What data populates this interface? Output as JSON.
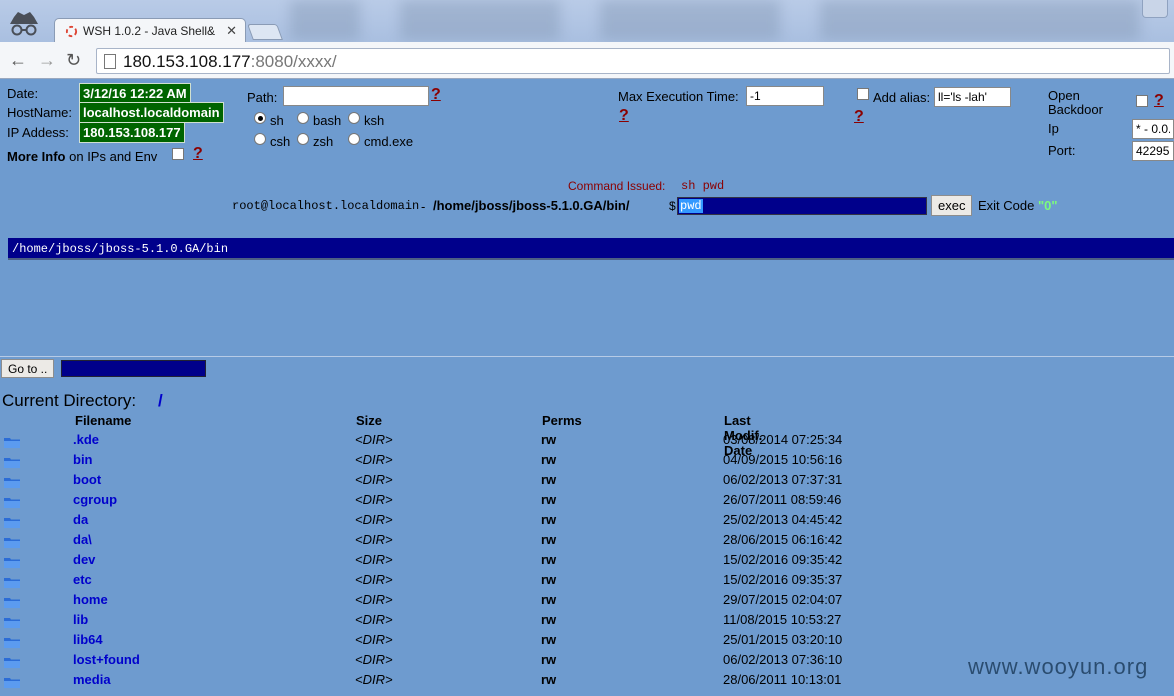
{
  "browser": {
    "tab_title": "WSH 1.0.2 - Java Shell&",
    "url_host": "180.153.108.177",
    "url_rest": ":8080/xxxx/"
  },
  "info": {
    "date_label": "Date:",
    "date_value": "3/12/16 12:22 AM",
    "hostname_label": "HostName:",
    "hostname_value": "localhost.localdomain",
    "ip_label": "IP Addess:",
    "ip_value": "180.153.108.177",
    "more_info_bold": "More Info",
    "more_info_rest": "on IPs and Env"
  },
  "shell": {
    "path_label": "Path:",
    "path_value": "",
    "help": "?",
    "options": [
      {
        "label": "sh",
        "selected": true
      },
      {
        "label": "bash",
        "selected": false
      },
      {
        "label": "ksh",
        "selected": false
      },
      {
        "label": "csh",
        "selected": false
      },
      {
        "label": "zsh",
        "selected": false
      },
      {
        "label": "cmd.exe",
        "selected": false
      }
    ]
  },
  "exec_settings": {
    "max_time_label": "Max Execution Time:",
    "max_time_value": "-1",
    "alias_label": "Add alias:",
    "alias_value": "ll='ls -lah'"
  },
  "backdoor": {
    "label_line1": "Open",
    "label_line2": "Backdoor",
    "ip_label": "Ip",
    "ip_value": "* - 0.0.",
    "port_label": "Port:",
    "port_value": "42295"
  },
  "command": {
    "issued_label": "Command Issued:",
    "issued_value": "sh pwd",
    "prompt_user": "root@localhost.localdomain",
    "prompt_sep": " - ",
    "prompt_dir": "/home/jboss/jboss-5.1.0.GA/bin/",
    "prompt_symbol": "$",
    "input_value": "pwd",
    "exec_button": "exec",
    "exit_code_label": "Exit Code",
    "exit_code_value": "\"0\""
  },
  "output": "/home/jboss/jboss-5.1.0.GA/bin",
  "goto": {
    "button": "Go to ..",
    "value": ""
  },
  "current_directory": {
    "label": "Current Directory:",
    "value": "/"
  },
  "file_table": {
    "headers": [
      "Filename",
      "Size",
      "Perms",
      "Last Modif. Date"
    ],
    "rows": [
      {
        "name": ".kde",
        "size": "<DIR>",
        "perms": "rw",
        "date": "03/08/2014 07:25:34"
      },
      {
        "name": "bin",
        "size": "<DIR>",
        "perms": "rw",
        "date": "04/09/2015 10:56:16"
      },
      {
        "name": "boot",
        "size": "<DIR>",
        "perms": "rw",
        "date": "06/02/2013 07:37:31"
      },
      {
        "name": "cgroup",
        "size": "<DIR>",
        "perms": "rw",
        "date": "26/07/2011 08:59:46"
      },
      {
        "name": "da",
        "size": "<DIR>",
        "perms": "rw",
        "date": "25/02/2013 04:45:42"
      },
      {
        "name": "da\\",
        "size": "<DIR>",
        "perms": "rw",
        "date": "28/06/2015 06:16:42"
      },
      {
        "name": "dev",
        "size": "<DIR>",
        "perms": "rw",
        "date": "15/02/2016 09:35:42"
      },
      {
        "name": "etc",
        "size": "<DIR>",
        "perms": "rw",
        "date": "15/02/2016 09:35:37"
      },
      {
        "name": "home",
        "size": "<DIR>",
        "perms": "rw",
        "date": "29/07/2015 02:04:07"
      },
      {
        "name": "lib",
        "size": "<DIR>",
        "perms": "rw",
        "date": "11/08/2015 10:53:27"
      },
      {
        "name": "lib64",
        "size": "<DIR>",
        "perms": "rw",
        "date": "25/01/2015 03:20:10"
      },
      {
        "name": "lost+found",
        "size": "<DIR>",
        "perms": "rw",
        "date": "06/02/2013 07:36:10"
      },
      {
        "name": "media",
        "size": "<DIR>",
        "perms": "rw",
        "date": "28/06/2011 10:13:01"
      }
    ]
  },
  "watermark": "www.wooyun.org",
  "colors": {
    "page_bg": "#6e9bcf",
    "badge_green": "#006400",
    "output_bg": "#00008b",
    "link_blue": "#0000cc",
    "help_red": "#8b0000"
  }
}
